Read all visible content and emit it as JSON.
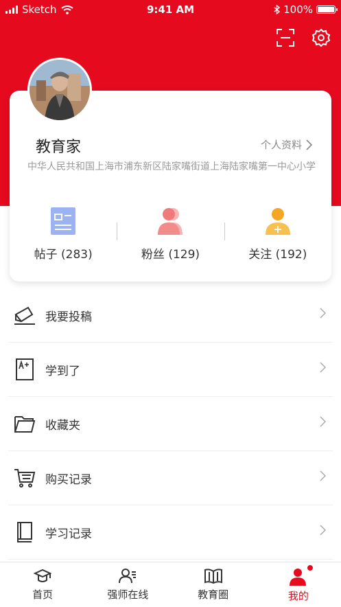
{
  "status_bar": {
    "carrier": "Sketch",
    "time": "9:41 AM",
    "battery": "100%"
  },
  "header": {
    "scan_icon": "scan-icon",
    "settings_icon": "gear-icon"
  },
  "profile": {
    "name": "教育家",
    "profile_link": "个人资料",
    "school": "中华人民共和国上海市浦东新区陆家嘴街道上海陆家嘴第一中心小学",
    "stats": [
      {
        "label": "帖子 (283)",
        "icon": "posts-icon",
        "color": "#6f8fe8"
      },
      {
        "label": "粉丝 (129)",
        "icon": "fans-icon",
        "color": "#f07a7a"
      },
      {
        "label": "关注 (192)",
        "icon": "follow-icon",
        "color": "#f5a623"
      }
    ]
  },
  "menu": {
    "items": [
      {
        "label": "我要投稿",
        "icon": "submit-icon"
      },
      {
        "label": "学到了",
        "icon": "learned-icon"
      },
      {
        "label": "收藏夹",
        "icon": "folder-icon"
      },
      {
        "label": "购买记录",
        "icon": "cart-icon"
      },
      {
        "label": "学习记录",
        "icon": "book-icon"
      }
    ]
  },
  "tabs": [
    {
      "label": "首页",
      "icon": "home-icon"
    },
    {
      "label": "强师在线",
      "icon": "teacher-icon"
    },
    {
      "label": "教育圈",
      "icon": "circle-icon"
    },
    {
      "label": "我的",
      "icon": "me-icon",
      "active": true
    }
  ],
  "colors": {
    "brand": "#e60a1f"
  }
}
